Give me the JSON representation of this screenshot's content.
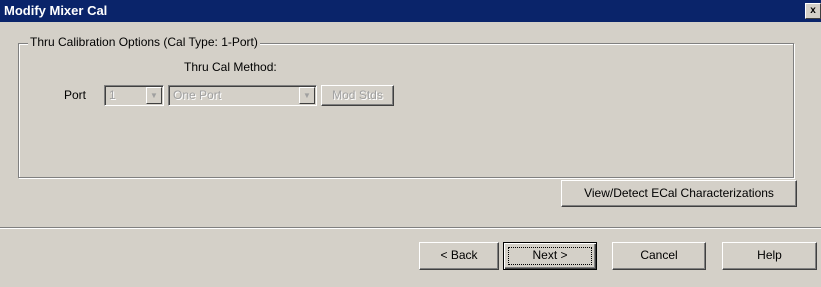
{
  "window": {
    "title": "Modify Mixer Cal",
    "close_glyph": "x"
  },
  "group": {
    "legend": "Thru Calibration Options (Cal Type: 1-Port)",
    "method_heading": "Thru Cal Method:",
    "port_label": "Port",
    "port_value": "1",
    "method_value": "One Port",
    "mod_stds_label": "Mod Stds"
  },
  "ecal_button_label": "View/Detect ECal Characterizations",
  "footer": {
    "back_label": "< Back",
    "next_label": "Next >",
    "cancel_label": "Cancel",
    "help_label": "Help"
  }
}
